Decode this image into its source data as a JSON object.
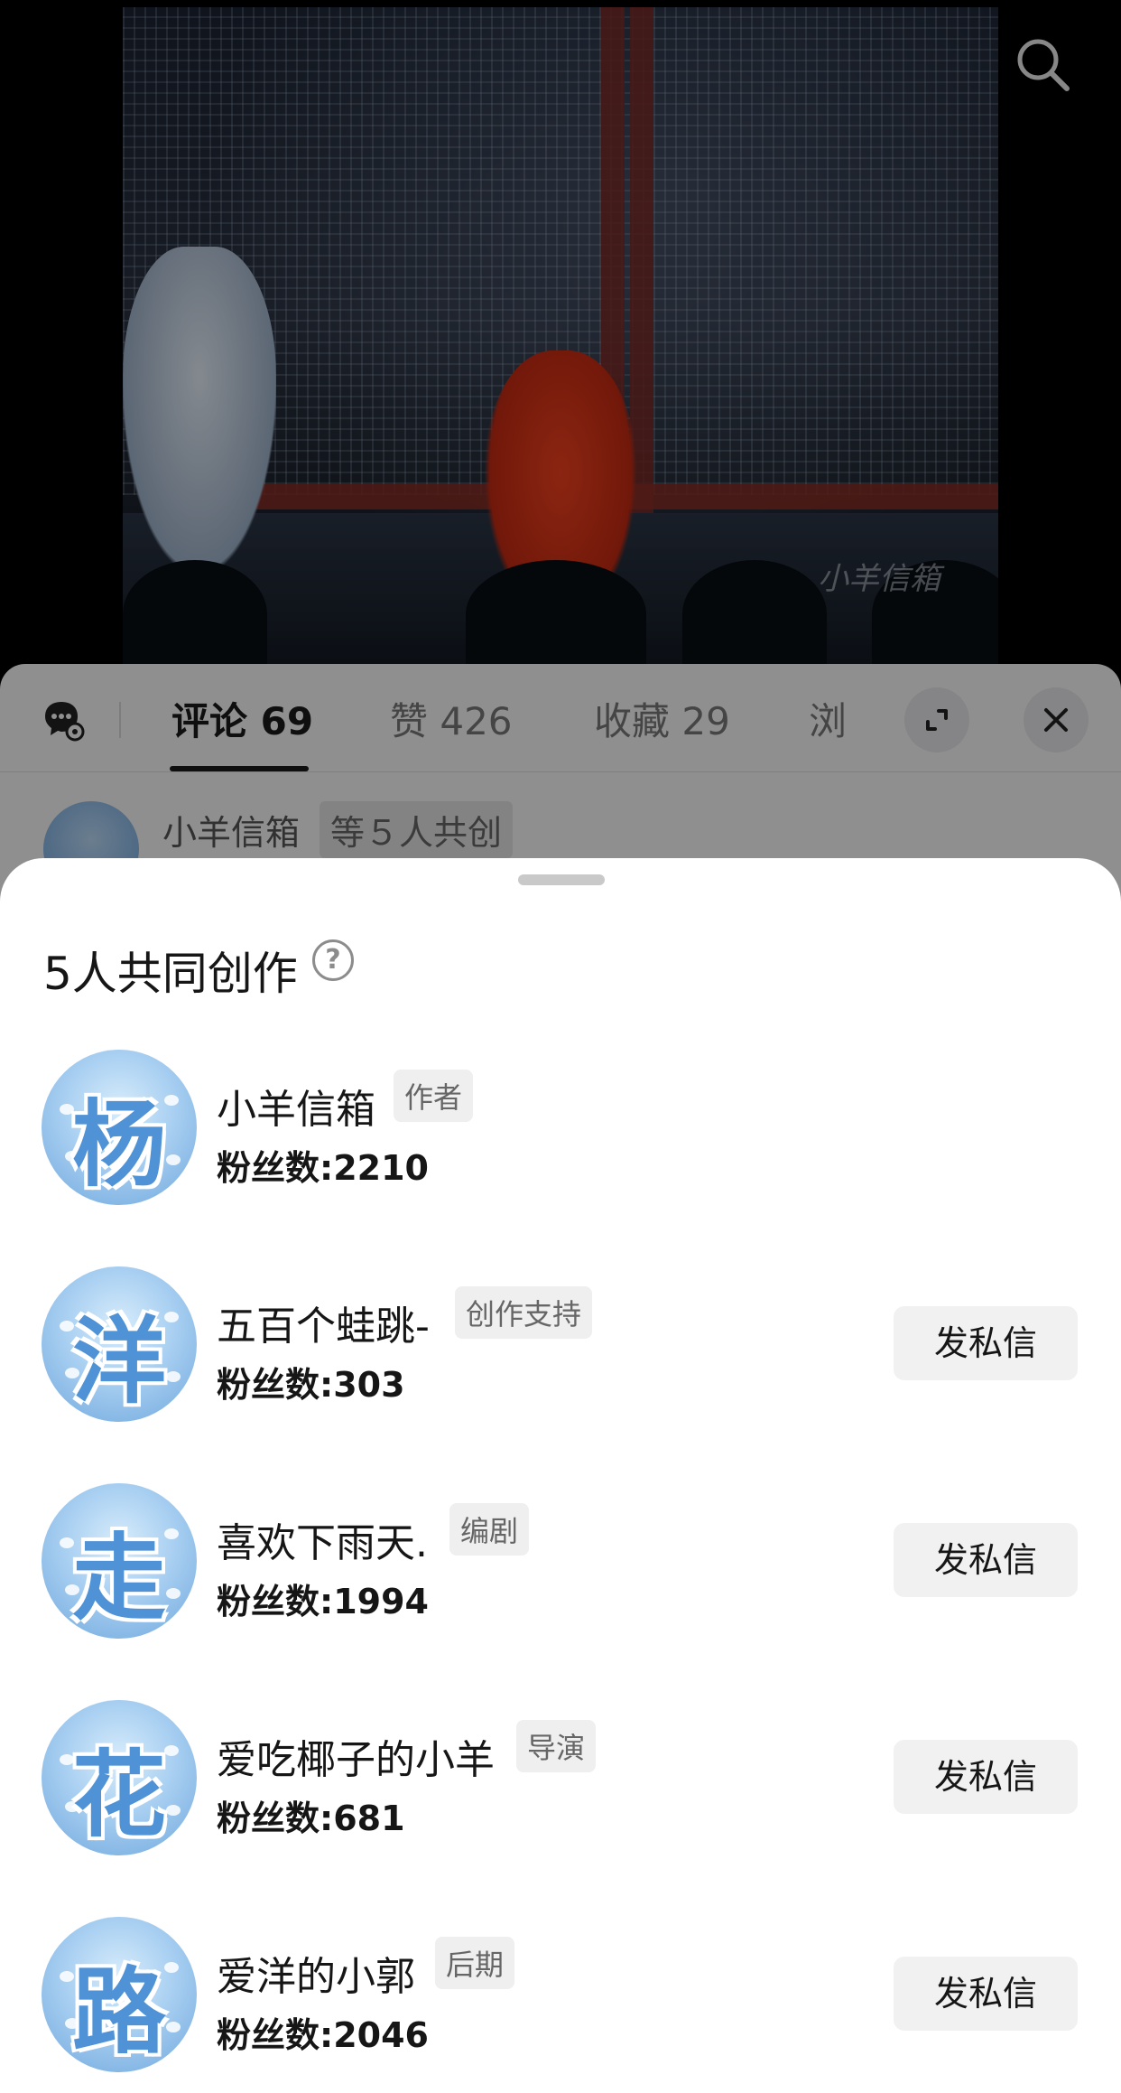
{
  "video": {
    "watermark": "小羊信箱",
    "search_icon": "search-icon"
  },
  "comments_panel": {
    "tabs": [
      {
        "label": "评论 69",
        "active": true
      },
      {
        "label": "赞 426",
        "active": false
      },
      {
        "label": "收藏 29",
        "active": false
      },
      {
        "label": "浏",
        "active": false
      }
    ],
    "icons": {
      "chat": "chat-settings-icon",
      "expand": "expand-icon",
      "close": "close-icon"
    },
    "first_comment": {
      "name": "小羊信箱",
      "chip": "等５人共创"
    }
  },
  "sheet": {
    "title": "5人共同创作",
    "help_icon": "question-circle-icon",
    "members": [
      {
        "avatar_char": "杨",
        "name": "小羊信箱",
        "role": "作者",
        "fans": "粉丝数:2210",
        "dm_label": null
      },
      {
        "avatar_char": "洋",
        "name": "五百个蛙跳-",
        "role": "创作支持",
        "fans": "粉丝数:303",
        "dm_label": "发私信"
      },
      {
        "avatar_char": "走",
        "name": "喜欢下雨天.",
        "role": "编剧",
        "fans": "粉丝数:1994",
        "dm_label": "发私信"
      },
      {
        "avatar_char": "花",
        "name": "爱吃椰子的小羊",
        "role": "导演",
        "fans": "粉丝数:681",
        "dm_label": "发私信"
      },
      {
        "avatar_char": "路",
        "name": "爱洋的小郭",
        "role": "后期",
        "fans": "粉丝数:2046",
        "dm_label": "发私信"
      }
    ]
  },
  "colors": {
    "accent_text": "#161616",
    "avatar_blue": "#4f92d6",
    "button_bg": "#f1f1f2",
    "badge_bg": "#efefef"
  }
}
